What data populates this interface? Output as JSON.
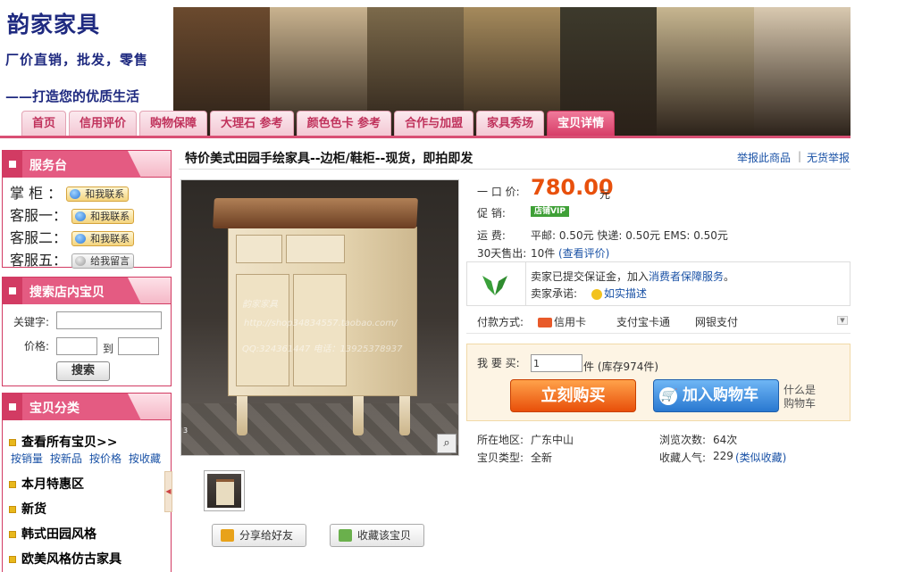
{
  "header": {
    "brand": "韵家家具",
    "slogan1": "厂价直销，批发，零售",
    "slogan2": "——打造您的优质生活",
    "banner_colors": [
      "#6b4a2e",
      "#c9b38f",
      "#7c6a4b",
      "#a58a5c",
      "#3d3a2c",
      "#c7b690",
      "#d9c9b0"
    ]
  },
  "nav": {
    "tabs": [
      "首页",
      "信用评价",
      "购物保障",
      "大理石 参考",
      "颜色色卡 参考",
      "合作与加盟",
      "家具秀场",
      "宝贝详情"
    ],
    "active_index": 7
  },
  "sidebar": {
    "service": {
      "title": "服务台",
      "rows": [
        {
          "label": "掌 柜 ：",
          "button": "和我联系"
        },
        {
          "label": "客服一：",
          "button": "和我联系"
        },
        {
          "label": "客服二：",
          "button": "和我联系"
        },
        {
          "label": "客服五：",
          "button": "给我留言"
        }
      ]
    },
    "search": {
      "title": "搜索店内宝贝",
      "keyword_label": "关键字:",
      "price_label": "价格:",
      "to_label": "到",
      "button": "搜索"
    },
    "categories": {
      "title": "宝贝分类",
      "all_items": "查看所有宝贝>>",
      "sorts": [
        "按销量",
        "按新品",
        "按价格",
        "按收藏"
      ],
      "items": [
        "本月特惠区",
        "新货",
        "韩式田园风格",
        "欧美风格仿古家具"
      ]
    }
  },
  "product": {
    "title": "特价美式田园手绘家具--边柜/鞋柜--现货，即拍即发",
    "report_links": [
      "举报此商品",
      "无货举报"
    ],
    "watermark": [
      "韵家家具",
      "http://shop34834557.taobao.com/",
      "QQ:324361447 电话：13925378937"
    ],
    "image_index": "3",
    "price_label": "一 口 价:",
    "price": "780.00",
    "price_unit": "元",
    "promo_label": "促    销:",
    "promo_badge": "店铺VIP",
    "shipping_label": "运    费:",
    "shipping": "平邮: 0.50元 快递: 0.50元 EMS: 0.50元",
    "sold_label": "30天售出:",
    "sold": "10件",
    "view_reviews": "(查看评价)",
    "guarantee_line1_prefix": "卖家已提交保证金，加入",
    "guarantee_link": "消费者保障服务",
    "guarantee_line1_suffix": "。",
    "promise_label": "卖家承诺:",
    "promise_value": "如实描述",
    "payment_label": "付款方式:",
    "payments": [
      "信用卡",
      "支付宝卡通",
      "网银支付"
    ],
    "buy_label": "我 要 买:",
    "quantity": "1",
    "stock": "件 (库存974件)",
    "buy_now": "立刻购买",
    "add_cart": "加入购物车",
    "what_cart_1": "什么是",
    "what_cart_2": "购物车",
    "location_label": "所在地区:",
    "location": "广东中山",
    "type_label": "宝贝类型:",
    "type": "全新",
    "views_label": "浏览次数:",
    "views": "64次",
    "fav_label": "收藏人气:",
    "fav": "229",
    "similar_fav": "(类似收藏)",
    "share": "分享给好友",
    "collect": "收藏该宝贝"
  }
}
